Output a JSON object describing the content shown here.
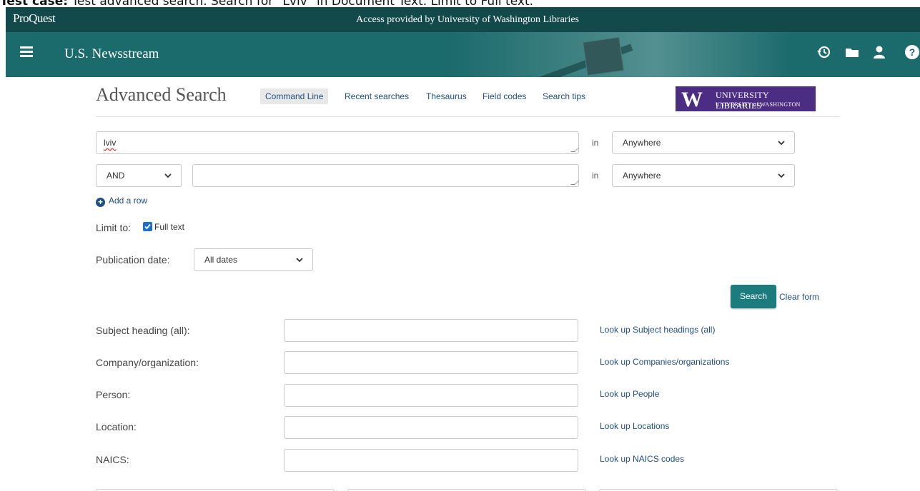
{
  "caption": {
    "prefix": "Test case:",
    "text": " Test advanced search. Search for \"Lviv\" in Document Text. Limit to Full text."
  },
  "topbar": {
    "brand": "ProQuest",
    "access": "Access provided by University of Washington Libraries"
  },
  "navbar": {
    "product": "U.S. Newsstream",
    "icons": [
      "history-icon",
      "folder-icon",
      "user-icon",
      "help-icon"
    ]
  },
  "header": {
    "title": "Advanced Search",
    "links": [
      "Command Line",
      "Recent searches",
      "Thesaurus",
      "Field codes",
      "Search tips"
    ],
    "logo": {
      "letter": "W",
      "line1": "UNIVERSITY LIBRARIES",
      "line2": "UNIVERSITY of WASHINGTON"
    }
  },
  "search_rows": [
    {
      "value": "lviv",
      "in_label": "in",
      "field": "Anywhere"
    },
    {
      "operator": "AND",
      "value": "",
      "in_label": "in",
      "field": "Anywhere"
    }
  ],
  "add_row": "Add a row",
  "limit": {
    "label": "Limit to:",
    "full_text_label": "Full text",
    "full_text_checked": true
  },
  "publication_date": {
    "label": "Publication date:",
    "value": "All dates"
  },
  "actions": {
    "search": "Search",
    "clear": "Clear form"
  },
  "fields": [
    {
      "label": "Subject heading (all):",
      "lookup": "Look up Subject headings (all)"
    },
    {
      "label": "Company/organization:",
      "lookup": "Look up Companies/organizations"
    },
    {
      "label": "Person:",
      "lookup": "Look up People"
    },
    {
      "label": "Location:",
      "lookup": "Look up Locations"
    },
    {
      "label": "NAICS:",
      "lookup": "Look up NAICS codes"
    }
  ],
  "colors": {
    "topbar": "#124a4c",
    "navbar": "#1b6a6c",
    "link": "#1f4f81",
    "search_button": "#1c7b7d",
    "uw_purple": "#4b2e83"
  }
}
